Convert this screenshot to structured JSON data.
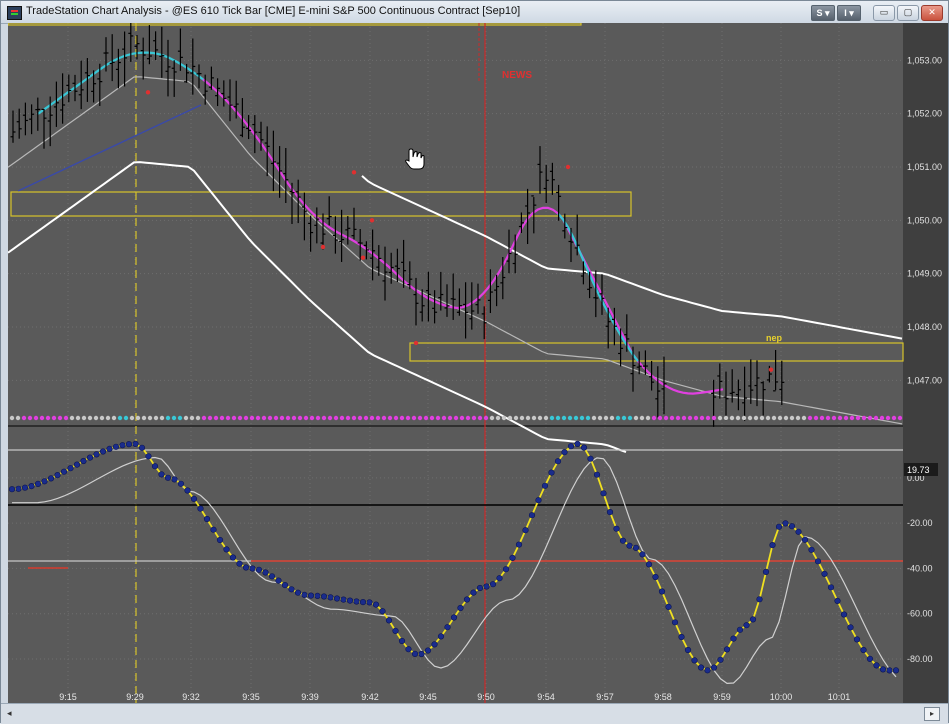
{
  "window": {
    "title": "TradeStation Chart Analysis - @ES 610 Tick Bar [CME] E-mini S&P 500 Continuous Contract [Sep10]",
    "s_button": "S",
    "i_button": "I",
    "minimize": "▭",
    "restore": "▢",
    "close": "✕"
  },
  "colors": {
    "background": "#5a5a5a",
    "price_bars": "#000000",
    "avg_line": "#39c7d6",
    "avg_line_down": "#e040e0",
    "bands": "#ffffff",
    "zones": "#d7c32a",
    "news_line": "#cc2a2a",
    "oscillator_dots": "#1a2c8c",
    "oscillator_line": "#f0e020",
    "zero_line": "#000000",
    "level_line": "#d43b2c"
  },
  "annotations": {
    "news_label": "NEWS",
    "nep_label": "nep"
  },
  "price_axis": {
    "labels": [
      "1,053.00",
      "1,052.00",
      "1,051.00",
      "1,050.00",
      "1,049.00",
      "1,048.00",
      "1,047.00"
    ]
  },
  "oscillator_axis": {
    "current_value": "19.73",
    "labels": [
      "0.00",
      "-20.00",
      "-40.00",
      "-60.00",
      "-80.00"
    ]
  },
  "time_axis": {
    "labels": [
      "9:15",
      "9:29",
      "9:32",
      "9:35",
      "9:39",
      "9:42",
      "9:45",
      "9:50",
      "9:54",
      "9:57",
      "9:58",
      "9:59",
      "10:00",
      "10:01"
    ]
  },
  "chart_data": {
    "type": "line",
    "title": "@ES 610 Tick Bar [CME] E-mini S&P 500 Continuous Contract [Sep10]",
    "x": [
      "9:15",
      "9:29",
      "9:32",
      "9:35",
      "9:39",
      "9:42",
      "9:45",
      "9:50",
      "9:54",
      "9:57",
      "9:58",
      "9:59",
      "10:00",
      "10:01"
    ],
    "price_ylim": [
      1046.2,
      1053.7
    ],
    "series": [
      {
        "values": [
          1052.4,
          1053.3,
          1052.9,
          1051.8,
          1050.0,
          1049.5,
          1048.4,
          1048.3,
          1051.0,
          1048.2,
          1046.7,
          1046.8,
          1047.1,
          1047.0
        ]
      },
      {
        "values": [
          1051.8,
          1052.7,
          1052.6,
          1051.2,
          1050.1,
          1049.1,
          1048.6,
          1048.1,
          1047.5,
          1047.4,
          1047.0,
          1046.7,
          1046.6,
          1046.4
        ]
      }
    ],
    "oscillator": {
      "ylim": [
        -95,
        22
      ],
      "values": [
        -5,
        15,
        0,
        -40,
        -52,
        -55,
        -78,
        -48,
        15,
        -30,
        -85,
        -65,
        -20,
        -85
      ]
    }
  }
}
